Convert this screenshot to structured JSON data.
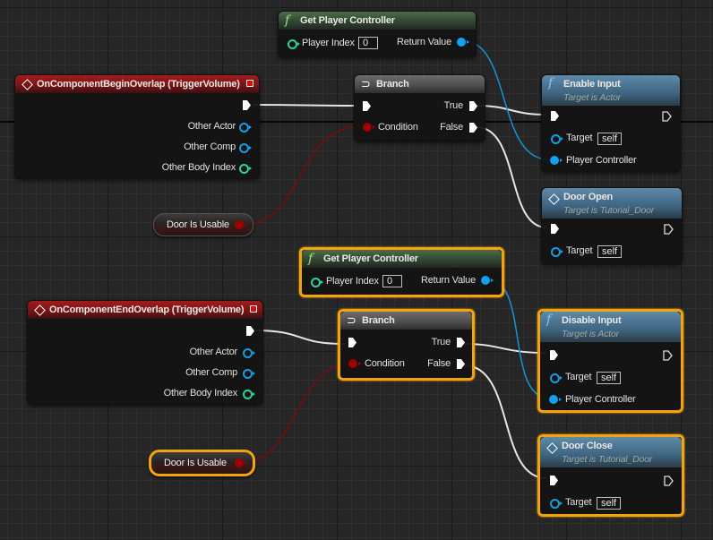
{
  "colors": {
    "exec_wire": "#e6e6e6",
    "object_wire": "#1393d8",
    "bool_wire": "#7a0c0c",
    "selection": "#f3a30d",
    "event_header": "#a31c1c",
    "pure_header": "#4c6c48",
    "function_header": "#5e8aa8",
    "branch_header": "#5a5a5a"
  },
  "nodes": {
    "get_pc_1": {
      "title": "Get Player Controller",
      "icon": "function-icon",
      "player_index_label": "Player Index",
      "player_index_value": "0",
      "return_label": "Return Value"
    },
    "begin_overlap": {
      "title": "OnComponentBeginOverlap (TriggerVolume)",
      "icon": "event-diamond-icon",
      "pins": [
        "Other Actor",
        "Other Comp",
        "Other Body Index"
      ]
    },
    "branch_1": {
      "title": "Branch",
      "icon": "branch-icon",
      "condition_label": "Condition",
      "true_label": "True",
      "false_label": "False"
    },
    "enable_input": {
      "title": "Enable Input",
      "subtitle": "Target is Actor",
      "icon": "function-icon",
      "target_label": "Target",
      "target_value": "self",
      "pc_label": "Player Controller"
    },
    "door_open": {
      "title": "Door Open",
      "subtitle": "Target is Tutorial_Door",
      "icon": "event-diamond-icon",
      "target_label": "Target",
      "target_value": "self"
    },
    "door_usable_1": {
      "label": "Door Is Usable"
    },
    "get_pc_2": {
      "title": "Get Player Controller",
      "icon": "function-icon",
      "player_index_label": "Player Index",
      "player_index_value": "0",
      "return_label": "Return Value"
    },
    "end_overlap": {
      "title": "OnComponentEndOverlap (TriggerVolume)",
      "icon": "event-diamond-icon",
      "pins": [
        "Other Actor",
        "Other Comp",
        "Other Body Index"
      ]
    },
    "branch_2": {
      "title": "Branch",
      "icon": "branch-icon",
      "condition_label": "Condition",
      "true_label": "True",
      "false_label": "False"
    },
    "disable_input": {
      "title": "Disable Input",
      "subtitle": "Target is Actor",
      "icon": "function-icon",
      "target_label": "Target",
      "target_value": "self",
      "pc_label": "Player Controller"
    },
    "door_close": {
      "title": "Door Close",
      "subtitle": "Target is Tutorial_Door",
      "icon": "event-diamond-icon",
      "target_label": "Target",
      "target_value": "self"
    },
    "door_usable_2": {
      "label": "Door Is Usable"
    }
  },
  "connections": [
    {
      "from": "begin_overlap.exec_out",
      "to": "branch_1.exec_in",
      "type": "exec"
    },
    {
      "from": "branch_1.true",
      "to": "enable_input.exec_in",
      "type": "exec"
    },
    {
      "from": "branch_1.false",
      "to": "door_open.exec_in",
      "type": "exec"
    },
    {
      "from": "get_pc_1.return_value",
      "to": "enable_input.player_controller",
      "type": "object"
    },
    {
      "from": "door_usable_1.value",
      "to": "branch_1.condition",
      "type": "bool"
    },
    {
      "from": "end_overlap.exec_out",
      "to": "branch_2.exec_in",
      "type": "exec"
    },
    {
      "from": "branch_2.true",
      "to": "disable_input.exec_in",
      "type": "exec"
    },
    {
      "from": "branch_2.false",
      "to": "door_close.exec_in",
      "type": "exec"
    },
    {
      "from": "get_pc_2.return_value",
      "to": "disable_input.player_controller",
      "type": "object"
    },
    {
      "from": "door_usable_2.value",
      "to": "branch_2.condition",
      "type": "bool"
    }
  ]
}
